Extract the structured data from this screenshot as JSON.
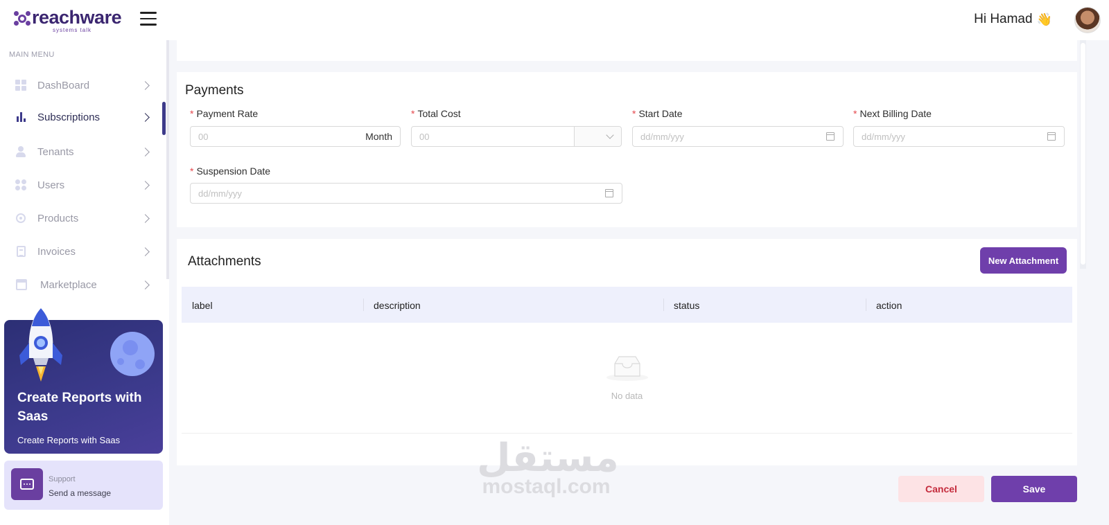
{
  "header": {
    "logo_name": "reachware",
    "logo_tagline": "systems talk",
    "greeting": "Hi Hamad",
    "greeting_emoji": "👋"
  },
  "sidebar": {
    "heading": "MAIN MENU",
    "items": [
      {
        "label": "DashBoard",
        "icon": "dashboard-icon"
      },
      {
        "label": "Subscriptions",
        "icon": "bar-chart-icon",
        "active": true
      },
      {
        "label": "Tenants",
        "icon": "user-icon"
      },
      {
        "label": "Users",
        "icon": "users-icon"
      },
      {
        "label": "Products",
        "icon": "target-icon"
      },
      {
        "label": "Invoices",
        "icon": "invoice-icon"
      },
      {
        "label": "Marketplace",
        "icon": "store-icon"
      }
    ],
    "promo": {
      "title": "Create Reports with Saas",
      "subtitle": "Create Reports with Saas"
    },
    "support": {
      "title": "Support",
      "subtitle": "Send a message"
    }
  },
  "payments": {
    "title": "Payments",
    "payment_rate": {
      "label": "Payment Rate",
      "placeholder": "00",
      "suffix": "Month"
    },
    "total_cost": {
      "label": "Total Cost",
      "placeholder": "00"
    },
    "start_date": {
      "label": "Start Date",
      "placeholder": "dd/mm/yyy"
    },
    "next_billing_date": {
      "label": "Next Billing Date",
      "placeholder": "dd/mm/yyy"
    },
    "suspension_date": {
      "label": "Suspension Date",
      "placeholder": "dd/mm/yyy"
    }
  },
  "attachments": {
    "title": "Attachments",
    "new_button": "New Attachment",
    "columns": [
      "label",
      "description",
      "status",
      "action"
    ],
    "empty_text": "No data"
  },
  "actions": {
    "cancel": "Cancel",
    "save": "Save"
  },
  "watermark": {
    "arabic": "مستقل",
    "latin": "mostaql.com"
  },
  "colors": {
    "brand": "#6f3fab",
    "navy": "#3d3a8a",
    "required": "#e5484d",
    "cancel_bg": "#fde3e5"
  }
}
